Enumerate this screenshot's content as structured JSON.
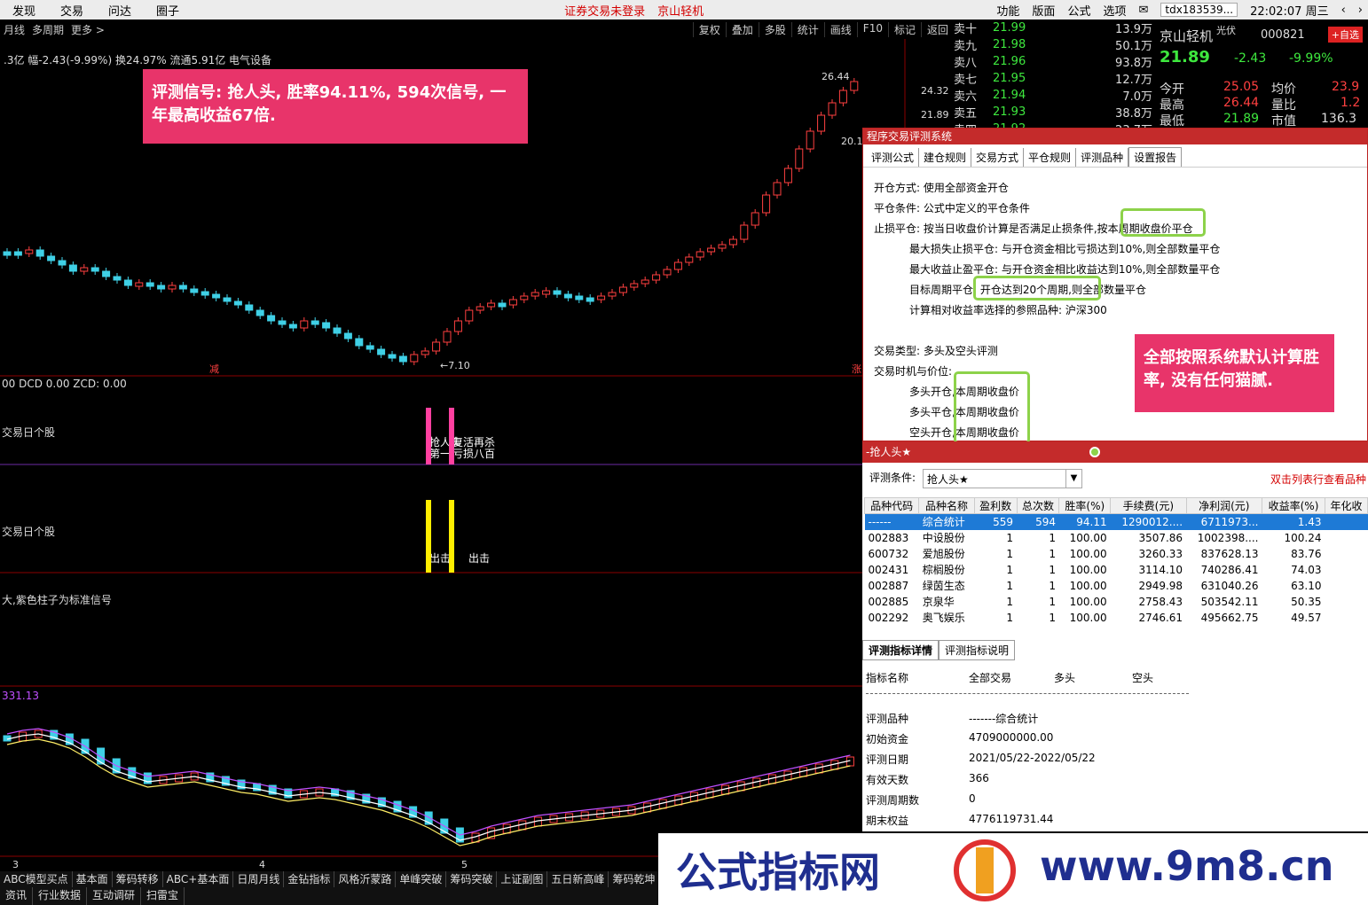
{
  "menubar": {
    "left": [
      "发现",
      "交易",
      "问达",
      "圈子"
    ],
    "center_notice": "证券交易未登录",
    "center_stock": "京山轻机",
    "right": [
      "功能",
      "版面",
      "公式",
      "选项"
    ],
    "user": "tdx183539...",
    "time": "22:02:07 周三"
  },
  "chart_toolbar": {
    "left": [
      "月线",
      "多周期",
      "更多 >"
    ],
    "right": [
      "复权",
      "叠加",
      "多股",
      "统计",
      "画线",
      "F10",
      "标记",
      "返回"
    ]
  },
  "chart_info": {
    "line": ".3亿 幅-2.43(-9.99%) 换24.97% 流通5.91亿 电气设备",
    "price_hi": "26.44",
    "price_hi_arrow": "←",
    "axis_ticks": [
      "24.32",
      "21.89"
    ],
    "left_label": "20.1",
    "low_label": "←7.10",
    "mark_left": "减",
    "mark_right": "涨",
    "sub1_header": "00 DCD 0.00 ZCD: 0.00",
    "sub1_label": "交易日个股",
    "sub1_sig_a": "抢人头",
    "sub1_sig_b": "复活再杀",
    "sub1_sig_c": "第一",
    "sub1_sig_d": "亏损八百",
    "sub2_label": "交易日个股",
    "sub2_sig_a": "出击",
    "sub2_sig_b": "出击",
    "sub3_label": "大,紫色柱子为标准信号",
    "sub4_header": "331.13",
    "dates": [
      "3",
      "4",
      "5"
    ]
  },
  "orderbook": [
    {
      "label": "卖十",
      "price": "21.99",
      "vol": "13.9万"
    },
    {
      "label": "卖九",
      "price": "21.98",
      "vol": "50.1万"
    },
    {
      "label": "卖八",
      "price": "21.96",
      "vol": "93.8万"
    },
    {
      "label": "卖七",
      "price": "21.95",
      "vol": "12.7万"
    },
    {
      "label": "卖六",
      "price": "21.94",
      "vol": "7.0万"
    },
    {
      "label": "卖五",
      "price": "21.93",
      "vol": "38.8万"
    },
    {
      "label": "卖四",
      "price": "21.92",
      "vol": "23.7万"
    }
  ],
  "quote": {
    "name": "京山轻机",
    "tag": "光伏",
    "code": "000821",
    "add_btn": "+自选",
    "price": "21.89",
    "change": "-2.43",
    "pct": "-9.99%",
    "kv": [
      {
        "k": "今开",
        "v": "25.05",
        "k2": "均价",
        "v2": "23.9"
      },
      {
        "k": "最高",
        "v": "26.44",
        "k2": "量比",
        "v2": "1.2"
      },
      {
        "k": "最低",
        "v": "21.89",
        "k2": "市值",
        "v2": "136.3"
      }
    ]
  },
  "eval": {
    "title": "程序交易评测系统",
    "tabs": [
      "评测公式",
      "建仓规则",
      "交易方式",
      "平仓规则",
      "评测品种",
      "设置报告"
    ],
    "lines": [
      "开仓方式: 使用全部资金开仓",
      "平仓条件: 公式中定义的平仓条件",
      "止损平仓: 按当日收盘价计算是否满足止损条件,按本周期收盘价平仓",
      "最大损失止损平仓: 与开仓资金相比亏损达到10%,则全部数量平仓",
      "最大收益止盈平仓: 与开仓资金相比收益达到10%,则全部数量平仓",
      "目标周期平仓: 开仓达到20个周期,则全部数量平仓",
      "计算相对收益率选择的参照品种: 沪深300",
      "交易类型: 多头及空头评测",
      "交易时机与价位:",
      "多头开仓,本周期收盘价",
      "多头平仓,本周期收盘价",
      "空头开仓,本周期收盘价"
    ]
  },
  "signal_panel": {
    "title": "-抢人头★",
    "cond_label": "评测条件:",
    "cond_value": "抢人头★",
    "hint": "双击列表行查看品种",
    "columns": [
      "品种代码",
      "品种名称",
      "盈利数",
      "总次数",
      "胜率(%)",
      "手续费(元)",
      "净利润(元)",
      "收益率(%)",
      "年化收"
    ],
    "rows": [
      [
        "------",
        "综合统计",
        "559",
        "594",
        "94.11",
        "1290012....",
        "6711973...",
        "1.43",
        ""
      ],
      [
        "002883",
        "中设股份",
        "1",
        "1",
        "100.00",
        "3507.86",
        "1002398....",
        "100.24",
        ""
      ],
      [
        "600732",
        "爱旭股份",
        "1",
        "1",
        "100.00",
        "3260.33",
        "837628.13",
        "83.76",
        ""
      ],
      [
        "002431",
        "棕榈股份",
        "1",
        "1",
        "100.00",
        "3114.10",
        "740286.41",
        "74.03",
        ""
      ],
      [
        "002887",
        "绿茵生态",
        "1",
        "1",
        "100.00",
        "2949.98",
        "631040.26",
        "63.10",
        ""
      ],
      [
        "002885",
        "京泉华",
        "1",
        "1",
        "100.00",
        "2758.43",
        "503542.11",
        "50.35",
        ""
      ],
      [
        "002292",
        "奥飞娱乐",
        "1",
        "1",
        "100.00",
        "2746.61",
        "495662.75",
        "49.57",
        ""
      ]
    ],
    "tabs": [
      "评测指标详情",
      "评测指标说明"
    ],
    "detail_header": [
      "指标名称",
      "全部交易",
      "多头",
      "空头"
    ],
    "details": [
      {
        "k": "评测品种",
        "v": "-------综合统计"
      },
      {
        "k": "初始资金",
        "v": "4709000000.00"
      },
      {
        "k": "评测日期",
        "v": "2021/05/22-2022/05/22"
      },
      {
        "k": "有效天数",
        "v": "366"
      },
      {
        "k": "评测周期数",
        "v": "0"
      },
      {
        "k": "期末权益",
        "v": "4776119731.44"
      }
    ]
  },
  "bottom_tabs": [
    "ABC模型买点",
    "基本面",
    "筹码转移",
    "ABC+基本面",
    "日周月线",
    "金钻指标",
    "风格沂蒙路",
    "单峰突破",
    "筹码突破",
    "上证副图",
    "五日新高峰",
    "筹码乾坤"
  ],
  "bottom_tabs2": [
    "资讯",
    "行业数据",
    "互动调研",
    "扫雷宝"
  ],
  "callouts": {
    "a": "评测信号: 抢人头, 胜率94.11%, 594次信号, 一年最高收益67倍.",
    "b": "全部按照系统默认计算胜率, 没有任何猫腻."
  },
  "watermark": {
    "left": "公式指标网",
    "right": "www.9m8.cn"
  },
  "colors": {
    "up": "#ff4040",
    "down": "#3fd0e6",
    "highlight": "#8dd24a",
    "callout": "#e8346a"
  }
}
